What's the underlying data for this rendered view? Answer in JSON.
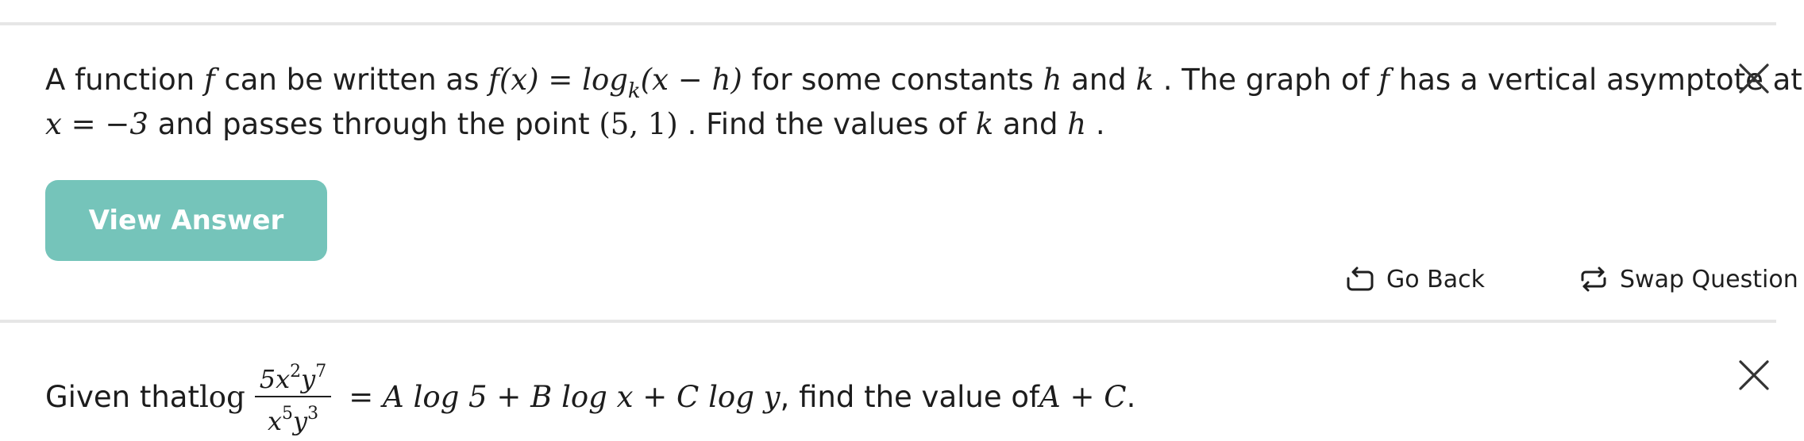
{
  "question1": {
    "line1": {
      "t1": "A function ",
      "f1": "f",
      "t2": " can be written as ",
      "expr_lhs": "f(x) = log",
      "expr_sub": "k",
      "expr_rhs": "(x − h)",
      "t3": " for some constants ",
      "h1": "h",
      "t4": " and ",
      "k1": "k",
      "t5": " . The graph of ",
      "f2": "f",
      "t6": " has a vertical asymptote at"
    },
    "line2": {
      "eq": "x = −3",
      "t1": " and passes through the point ",
      "pt": "(5, 1)",
      "t2": " . Find the values of ",
      "k": "k",
      "t3": " and ",
      "h": "h",
      "t4": " ."
    },
    "view_answer_label": "View Answer"
  },
  "actions": {
    "go_back_label": "Go Back",
    "swap_label": "Swap Question"
  },
  "question2": {
    "t1": "Given that ",
    "log": "log",
    "num": {
      "a": "5x",
      "b": "2",
      "c": "y",
      "d": "7"
    },
    "den": {
      "a": "x",
      "b": "5",
      "c": "y",
      "d": "3"
    },
    "rhs": "= A log 5 + B log x + C log y",
    "t2": " , find the value of ",
    "sum": "A + C",
    "t3": " ."
  },
  "icons": {
    "close": "close-icon",
    "go_back": "undo-arrow-icon",
    "swap": "swap-arrows-icon"
  },
  "colors": {
    "accent": "#75c4ba",
    "divider": "#e6e6e6",
    "text": "#1f1f1f"
  }
}
